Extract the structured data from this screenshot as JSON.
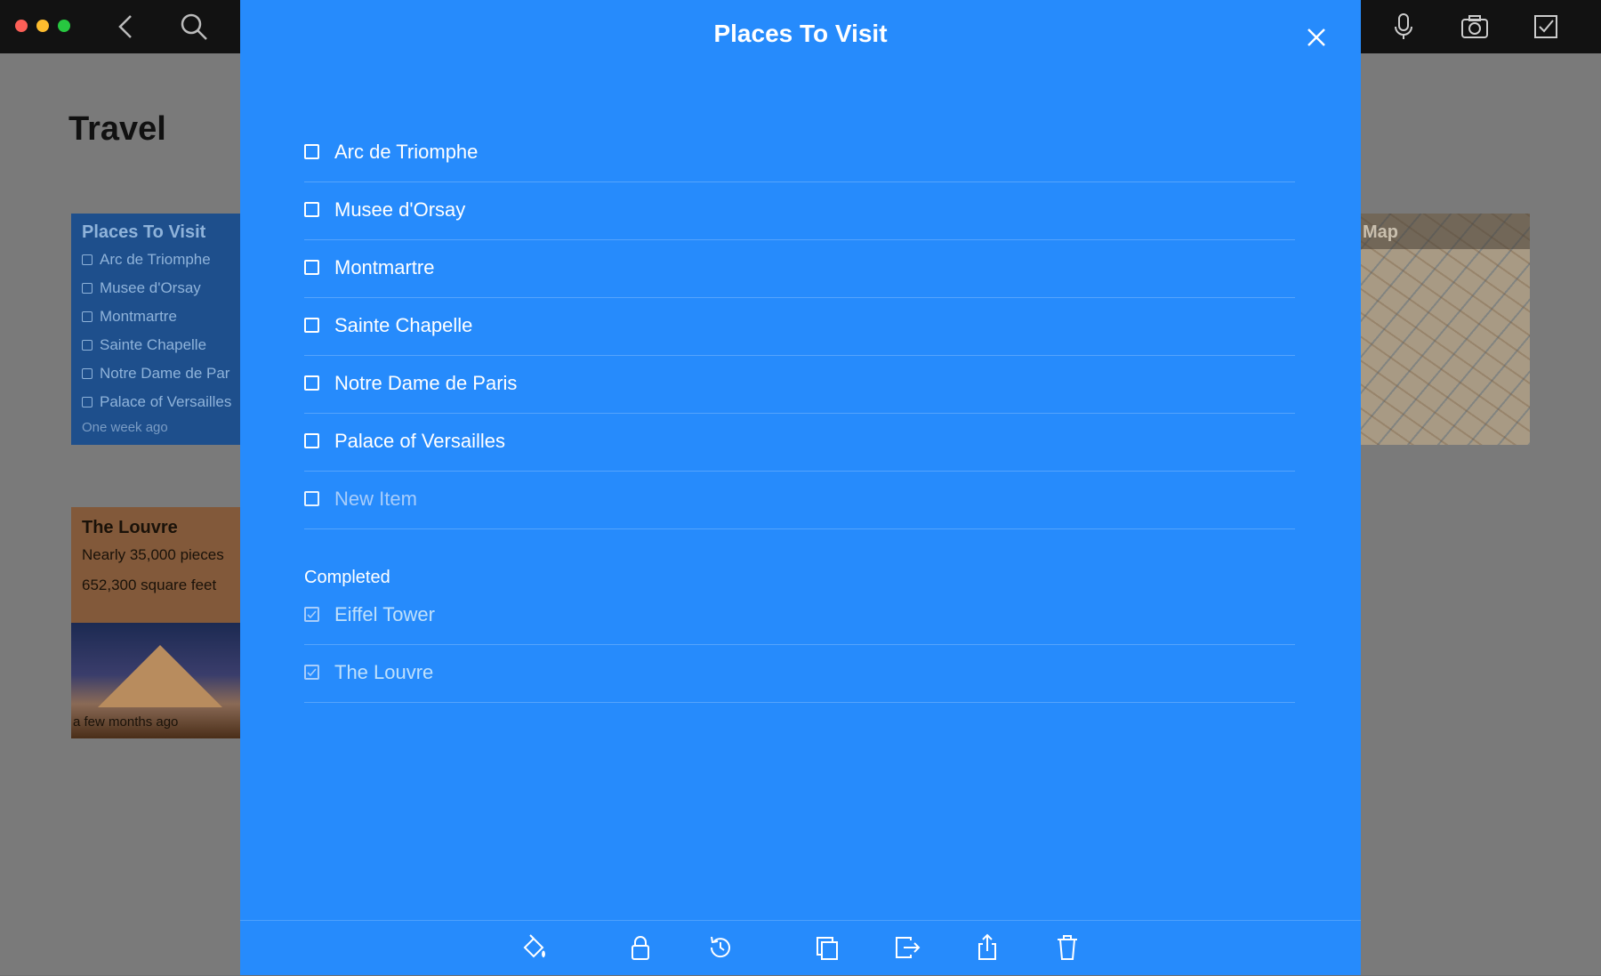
{
  "background": {
    "section_title": "Travel",
    "list_card": {
      "title": "Places To Visit",
      "items": [
        "Arc de Triomphe",
        "Musee d'Orsay",
        "Montmartre",
        "Sainte Chapelle",
        "Notre Dame de Par",
        "Palace of Versailles"
      ],
      "time": "One week ago"
    },
    "louvre_card": {
      "title": "The Louvre",
      "line1": "Nearly 35,000 pieces",
      "line2": "652,300 square feet",
      "time": "a few months ago"
    },
    "map_card": {
      "title": "Map"
    },
    "toolbar_icons": [
      "back-icon",
      "search-icon",
      "microphone-icon",
      "camera-icon",
      "checkbox-icon"
    ]
  },
  "modal": {
    "title": "Places To Visit",
    "items": [
      {
        "label": "Arc de Triomphe",
        "checked": false
      },
      {
        "label": "Musee d'Orsay",
        "checked": false
      },
      {
        "label": "Montmartre",
        "checked": false
      },
      {
        "label": "Sainte Chapelle",
        "checked": false
      },
      {
        "label": "Notre Dame de Paris",
        "checked": false
      },
      {
        "label": "Palace of Versailles",
        "checked": false
      }
    ],
    "new_item_placeholder": "New Item",
    "completed_heading": "Completed",
    "completed_items": [
      {
        "label": "Eiffel Tower",
        "checked": true
      },
      {
        "label": "The Louvre",
        "checked": true
      }
    ],
    "bottom_tools": [
      "paint-bucket-icon",
      "lock-icon",
      "history-icon",
      "duplicate-icon",
      "move-icon",
      "share-icon",
      "trash-icon"
    ]
  },
  "colors": {
    "modal_bg": "#268bfc",
    "topbar_bg": "#121212",
    "list_card_bg": "#1e4f8c",
    "louvre_card_bg": "#82593a"
  }
}
